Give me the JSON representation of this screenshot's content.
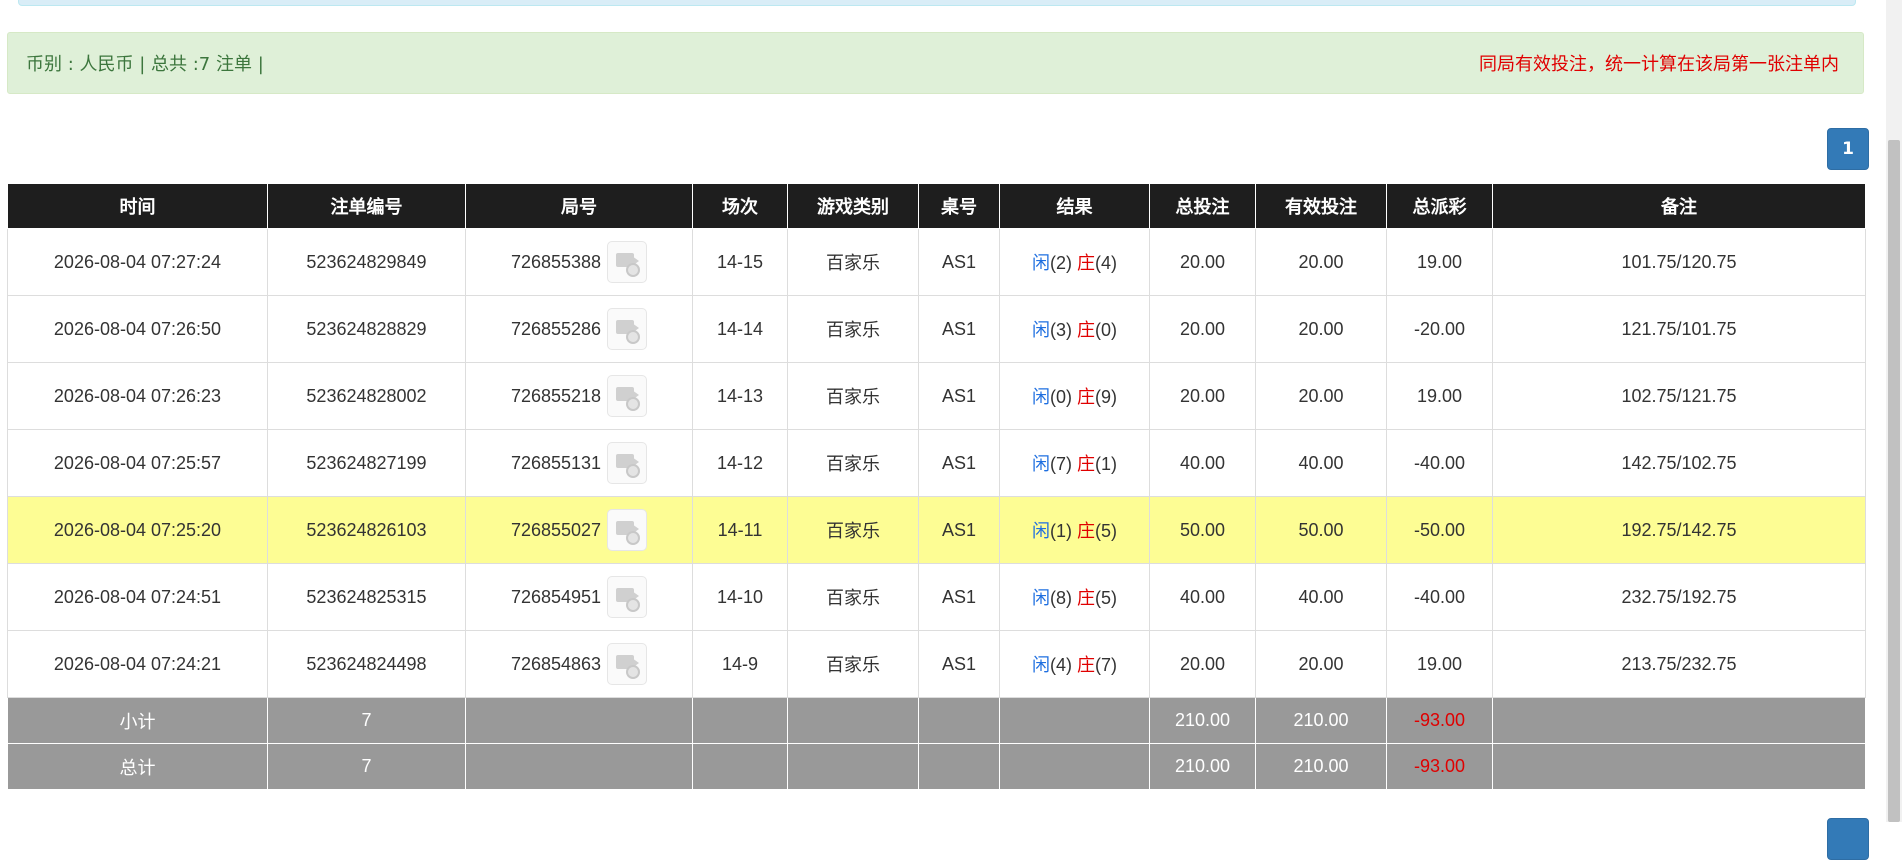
{
  "summary": {
    "currency_info": "币别 : 人民币 | 总共 :7 注单 |",
    "notice": "同局有效投注，统一计算在该局第一张注单内"
  },
  "pagination": {
    "current": "1"
  },
  "table": {
    "headers": [
      "时间",
      "注单编号",
      "局号",
      "场次",
      "游戏类别",
      "桌号",
      "结果",
      "总投注",
      "有效投注",
      "总派彩",
      "备注"
    ],
    "rows": [
      {
        "time": "2026-08-04 07:27:24",
        "bet_no": "523624829849",
        "round": "726855388",
        "session": "14-15",
        "game": "百家乐",
        "table": "AS1",
        "player_label": "闲",
        "player_score": "(2)",
        "banker_label": "庄",
        "banker_score": "(4)",
        "total_bet": "20.00",
        "valid_bet": "20.00",
        "payout": "19.00",
        "payout_negative": false,
        "remark": "101.75/120.75"
      },
      {
        "time": "2026-08-04 07:26:50",
        "bet_no": "523624828829",
        "round": "726855286",
        "session": "14-14",
        "game": "百家乐",
        "table": "AS1",
        "player_label": "闲",
        "player_score": "(3)",
        "banker_label": "庄",
        "banker_score": "(0)",
        "total_bet": "20.00",
        "valid_bet": "20.00",
        "payout": "-20.00",
        "payout_negative": true,
        "remark": "121.75/101.75"
      },
      {
        "time": "2026-08-04 07:26:23",
        "bet_no": "523624828002",
        "round": "726855218",
        "session": "14-13",
        "game": "百家乐",
        "table": "AS1",
        "player_label": "闲",
        "player_score": "(0)",
        "banker_label": "庄",
        "banker_score": "(9)",
        "total_bet": "20.00",
        "valid_bet": "20.00",
        "payout": "19.00",
        "payout_negative": false,
        "remark": "102.75/121.75"
      },
      {
        "time": "2026-08-04 07:25:57",
        "bet_no": "523624827199",
        "round": "726855131",
        "session": "14-12",
        "game": "百家乐",
        "table": "AS1",
        "player_label": "闲",
        "player_score": "(7)",
        "banker_label": "庄",
        "banker_score": "(1)",
        "total_bet": "40.00",
        "valid_bet": "40.00",
        "payout": "-40.00",
        "payout_negative": true,
        "remark": "142.75/102.75"
      },
      {
        "time": "2026-08-04 07:25:20",
        "bet_no": "523624826103",
        "round": "726855027",
        "session": "14-11",
        "game": "百家乐",
        "table": "AS1",
        "player_label": "闲",
        "player_score": "(1)",
        "banker_label": "庄",
        "banker_score": "(5)",
        "total_bet": "50.00",
        "valid_bet": "50.00",
        "payout": "-50.00",
        "payout_negative": true,
        "remark": "192.75/142.75",
        "highlighted": true
      },
      {
        "time": "2026-08-04 07:24:51",
        "bet_no": "523624825315",
        "round": "726854951",
        "session": "14-10",
        "game": "百家乐",
        "table": "AS1",
        "player_label": "闲",
        "player_score": "(8)",
        "banker_label": "庄",
        "banker_score": "(5)",
        "total_bet": "40.00",
        "valid_bet": "40.00",
        "payout": "-40.00",
        "payout_negative": true,
        "remark": "232.75/192.75"
      },
      {
        "time": "2026-08-04 07:24:21",
        "bet_no": "523624824498",
        "round": "726854863",
        "session": "14-9",
        "game": "百家乐",
        "table": "AS1",
        "player_label": "闲",
        "player_score": "(4)",
        "banker_label": "庄",
        "banker_score": "(7)",
        "total_bet": "20.00",
        "valid_bet": "20.00",
        "payout": "19.00",
        "payout_negative": false,
        "remark": "213.75/232.75"
      }
    ],
    "subtotal": {
      "label": "小计",
      "count": "7",
      "total_bet": "210.00",
      "valid_bet": "210.00",
      "payout": "-93.00"
    },
    "grand_total": {
      "label": "总计",
      "count": "7",
      "total_bet": "210.00",
      "valid_bet": "210.00",
      "payout": "-93.00"
    }
  },
  "icons": {
    "round_video": "video-replay-icon"
  },
  "colors": {
    "header_bg": "#1e1e1e",
    "positive_blue": "#1f6fe0",
    "negative_red": "#e00000",
    "highlight_row": "#fdfd94",
    "total_row_bg": "#999999",
    "summary_bg": "#dff0d8",
    "page_btn": "#337ab7"
  }
}
